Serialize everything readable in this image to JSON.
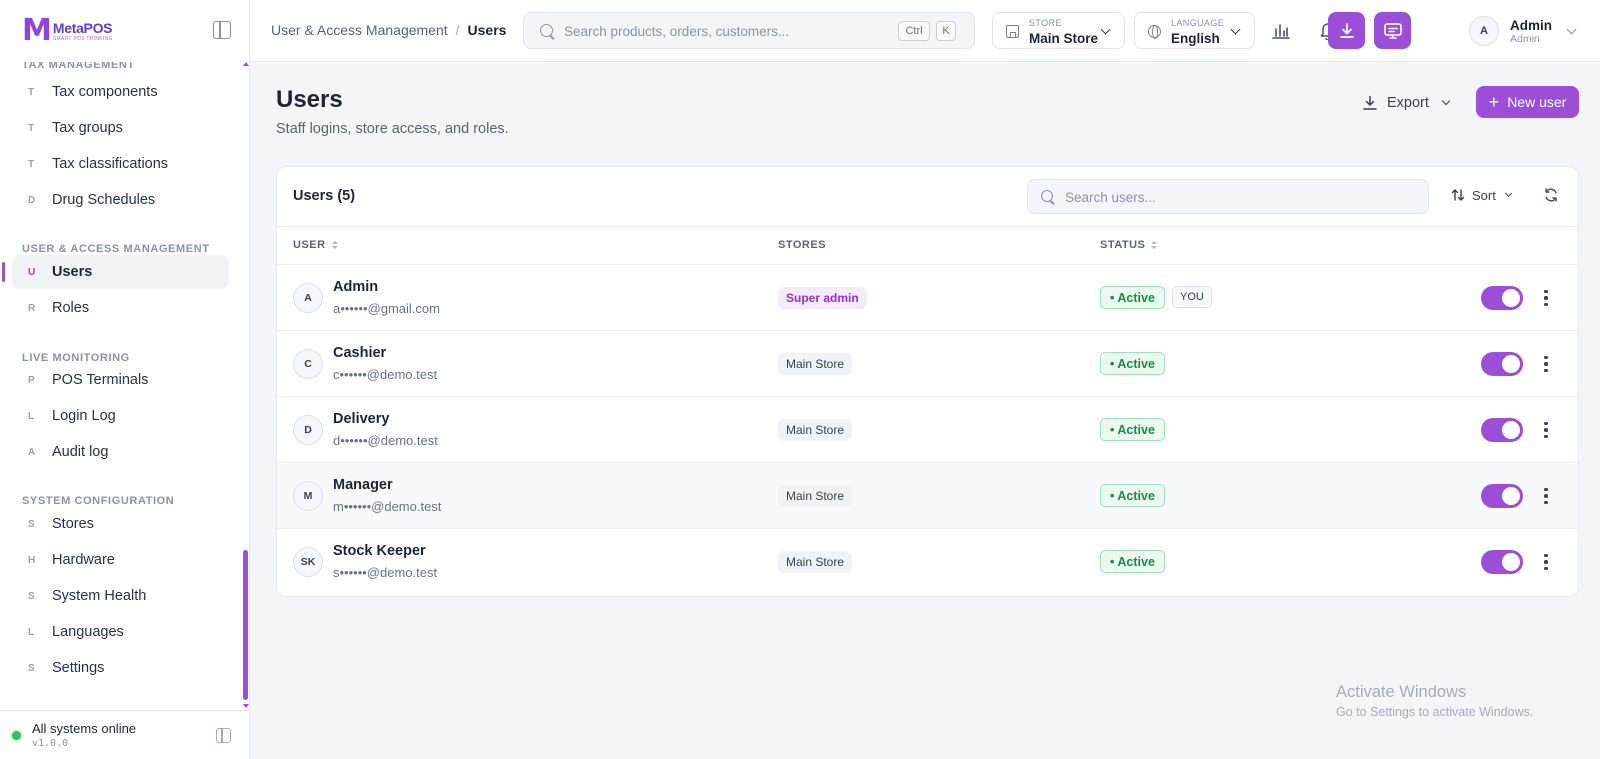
{
  "brand": {
    "logo_mark": "M",
    "name": "MetaPOS",
    "tagline": "SMART POS THINKING"
  },
  "sidebar": {
    "sections": [
      {
        "title": "TAX MANAGEMENT",
        "items": [
          {
            "letter": "T",
            "label": "Tax components"
          },
          {
            "letter": "T",
            "label": "Tax groups"
          },
          {
            "letter": "T",
            "label": "Tax classifications"
          },
          {
            "letter": "D",
            "label": "Drug Schedules"
          }
        ]
      },
      {
        "title": "USER & ACCESS MANAGEMENT",
        "items": [
          {
            "letter": "U",
            "label": "Users"
          },
          {
            "letter": "R",
            "label": "Roles"
          }
        ]
      },
      {
        "title": "LIVE MONITORING",
        "items": [
          {
            "letter": "P",
            "label": "POS Terminals"
          },
          {
            "letter": "L",
            "label": "Login Log"
          },
          {
            "letter": "A",
            "label": "Audit log"
          }
        ]
      },
      {
        "title": "SYSTEM CONFIGURATION",
        "items": [
          {
            "letter": "S",
            "label": "Stores"
          },
          {
            "letter": "H",
            "label": "Hardware"
          },
          {
            "letter": "S",
            "label": "System Health"
          },
          {
            "letter": "L",
            "label": "Languages"
          },
          {
            "letter": "S",
            "label": "Settings"
          }
        ]
      }
    ],
    "active_item": "Users",
    "footer": {
      "status": "All systems online",
      "version": "v1.0.0"
    }
  },
  "header": {
    "breadcrumb": {
      "parent": "User & Access Management",
      "separator": "/",
      "current": "Users"
    },
    "search": {
      "placeholder": "Search products, orders, customers...",
      "shortcut_ctrl": "Ctrl",
      "shortcut_key": "K"
    },
    "store": {
      "caption": "STORE",
      "value": "Main Store"
    },
    "language": {
      "caption": "LANGUAGE",
      "value": "English"
    },
    "user": {
      "initial": "A",
      "name": "Admin",
      "role": "Admin"
    }
  },
  "page": {
    "title": "Users",
    "subtitle": "Staff logins, store access, and roles.",
    "export_label": "Export",
    "new_user_label": "New user"
  },
  "table": {
    "title": "Users (5)",
    "search_placeholder": "Search users...",
    "sort_label": "Sort",
    "columns": {
      "user": "USER",
      "stores": "STORES",
      "status": "STATUS"
    },
    "rows": [
      {
        "initials": "A",
        "name": "Admin",
        "email": "a••••••@gmail.com",
        "store": "Super admin",
        "store_type": "super",
        "status": "• Active",
        "you": "YOU",
        "enabled": true
      },
      {
        "initials": "C",
        "name": "Cashier",
        "email": "c••••••@demo.test",
        "store": "Main Store",
        "store_type": "normal",
        "status": "• Active",
        "you": "",
        "enabled": true
      },
      {
        "initials": "D",
        "name": "Delivery",
        "email": "d••••••@demo.test",
        "store": "Main Store",
        "store_type": "normal",
        "status": "• Active",
        "you": "",
        "enabled": true
      },
      {
        "initials": "M",
        "name": "Manager",
        "email": "m••••••@demo.test",
        "store": "Main Store",
        "store_type": "normal",
        "status": "• Active",
        "you": "",
        "enabled": true
      },
      {
        "initials": "SK",
        "name": "Stock Keeper",
        "email": "s••••••@demo.test",
        "store": "Main Store",
        "store_type": "normal",
        "status": "• Active",
        "you": "",
        "enabled": true
      }
    ]
  },
  "watermark": {
    "title": "Activate Windows",
    "subtitle": "Go to Settings to activate Windows."
  },
  "colors": {
    "accent": "#9b4fd6",
    "success": "#1f8a47",
    "sidebar_bg": "#ffffff",
    "page_bg": "#f4f5f9"
  }
}
